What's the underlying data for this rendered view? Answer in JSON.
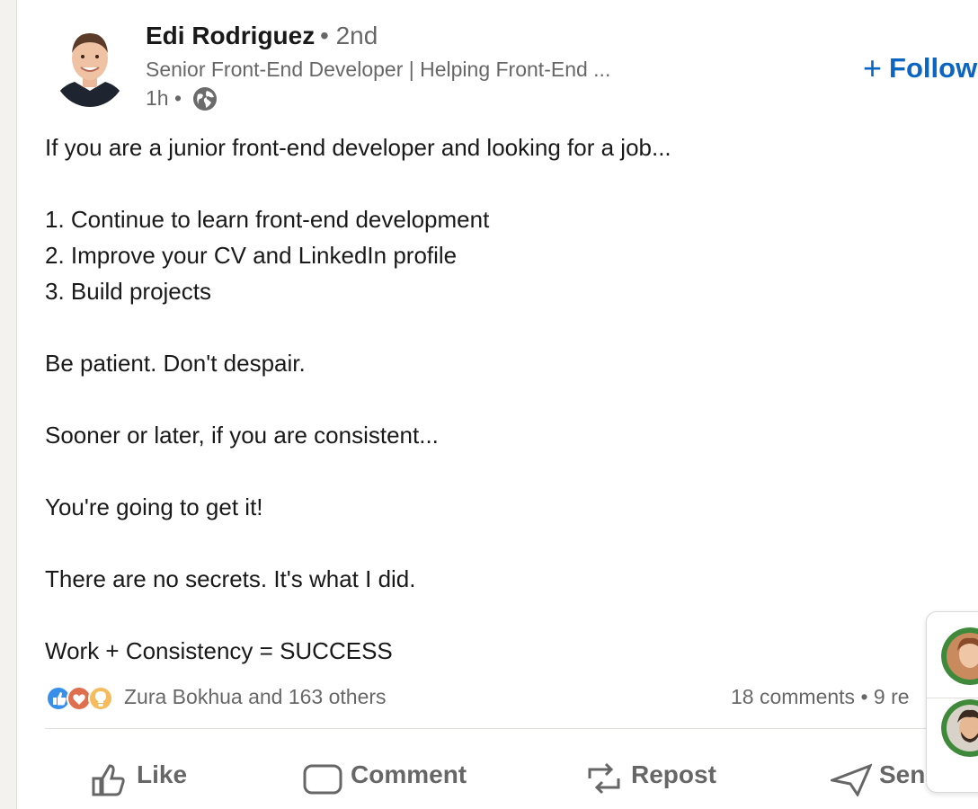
{
  "post": {
    "author_name": "Edi Rodriguez",
    "degree": "• 2nd",
    "headline": "Senior Front-End Developer | Helping Front-End ...",
    "time": "1h •",
    "follow_label": "Follow",
    "text_lines": [
      "If you are a junior front-end developer and looking for a job...",
      "",
      "1. Continue to learn front-end development",
      "2. Improve your CV and LinkedIn profile",
      "3. Build projects",
      "",
      "Be patient. Don't despair.",
      "",
      "Sooner or later, if you are consistent...",
      "",
      "You're going to get it!",
      "",
      "There are no secrets. It's what I did.",
      "",
      "Work + Consistency = SUCCESS"
    ],
    "reactions_text": "Zura Bokhua and 163 others",
    "comments_text": "18 comments • 9 re",
    "actions": {
      "like": "Like",
      "comment": "Comment",
      "repost": "Repost",
      "send": "Send"
    }
  },
  "icons": {
    "reactions": [
      "like-reaction-icon",
      "love-reaction-icon",
      "insightful-reaction-icon"
    ],
    "globe": "globe-icon"
  },
  "colors": {
    "brand": "#0a66c2",
    "like": "#378fe9",
    "love": "#df704d",
    "insightful": "#f5bb5c"
  }
}
